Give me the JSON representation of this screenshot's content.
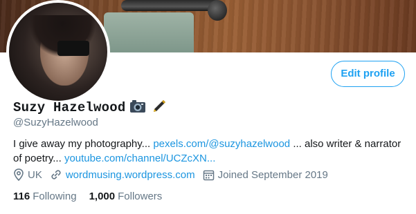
{
  "profile": {
    "name": "Suzy Hazelwood",
    "handle": "@SuzyHazelwood",
    "name_emojis": [
      "camera-emoji",
      "pen-emoji"
    ],
    "edit_button_label": "Edit profile",
    "bio": {
      "text1": "I give away my photography... ",
      "link1": "pexels.com/@suzyhazelwood",
      "text2": " ... also writer & narrator of poetry... ",
      "link2": "youtube.com/channel/UCZcXN..."
    },
    "location": "UK",
    "website": "wordmusing.wordpress.com",
    "joined": "Joined September 2019",
    "following_count": "116",
    "following_label": "Following",
    "followers_count": "1,000",
    "followers_label": "Followers"
  },
  "colors": {
    "accent": "#1da1f2",
    "link": "#1b95e0",
    "muted": "#657786",
    "text": "#14171a"
  },
  "icons": {
    "location": "location-pin-icon",
    "website": "link-icon",
    "joined": "calendar-icon"
  }
}
